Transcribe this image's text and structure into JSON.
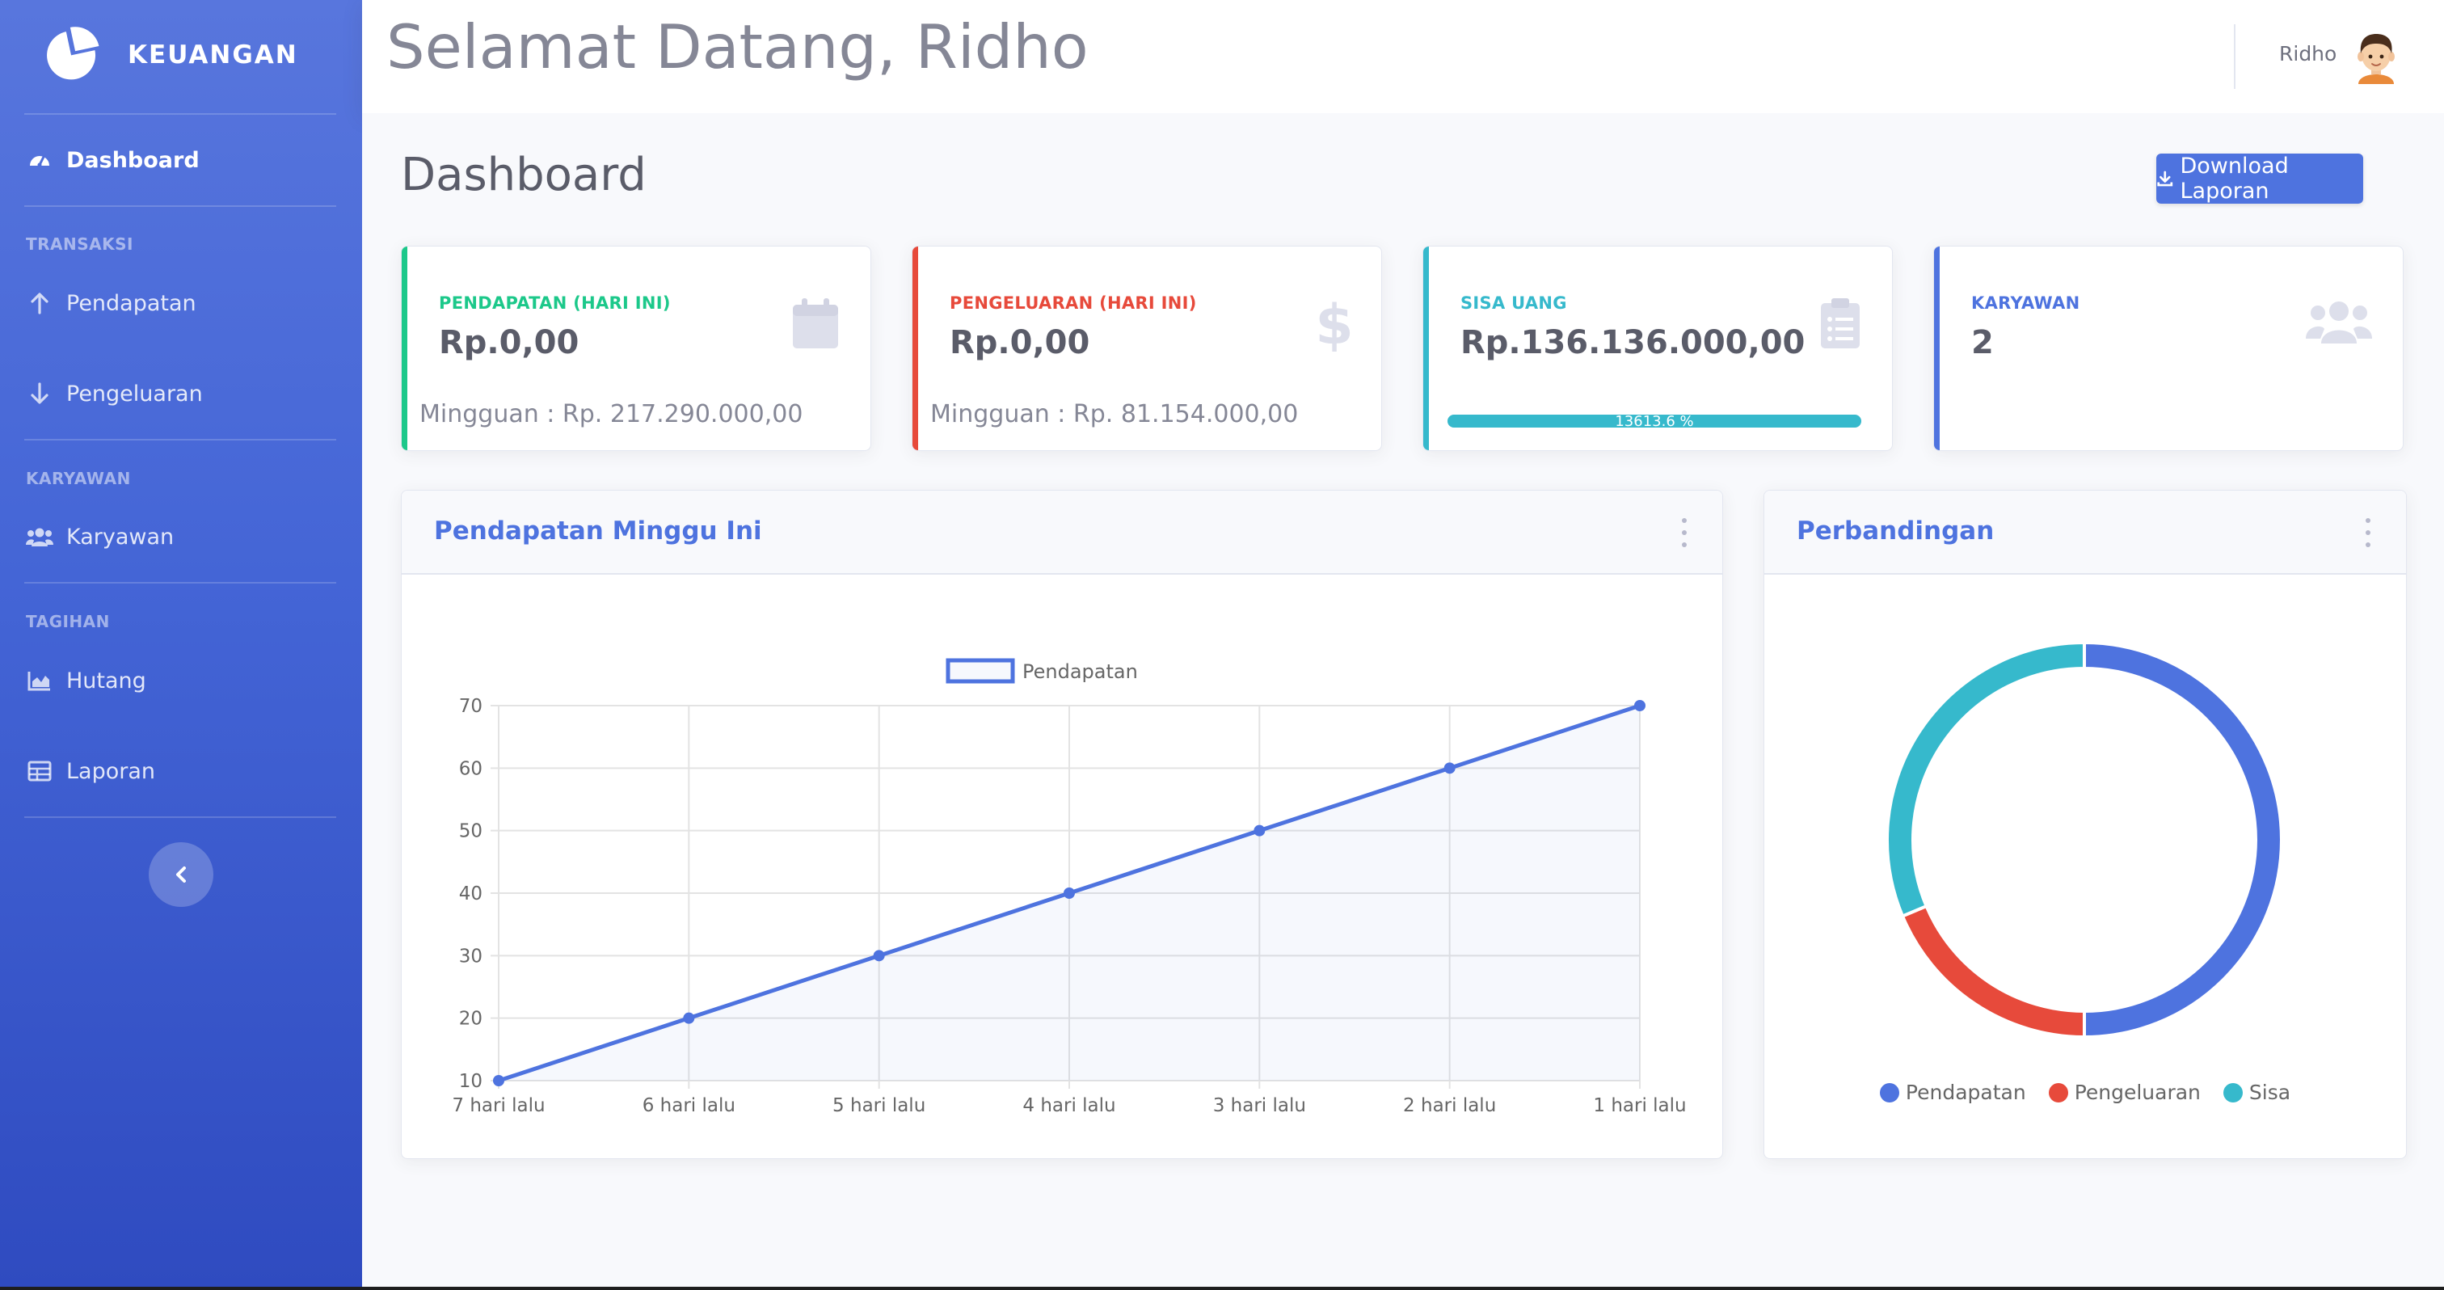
{
  "sidebar": {
    "brand": "KEUANGAN",
    "items": [
      {
        "label": "Dashboard"
      },
      {
        "heading": "TRANSAKSI"
      },
      {
        "label": "Pendapatan"
      },
      {
        "label": "Pengeluaran"
      },
      {
        "heading": "KARYAWAN"
      },
      {
        "label": "Karyawan"
      },
      {
        "heading": "TAGIHAN"
      },
      {
        "label": "Hutang"
      },
      {
        "label": "Laporan"
      }
    ]
  },
  "topbar": {
    "welcome": "Selamat Datang, Ridho",
    "user_name": "Ridho"
  },
  "page": {
    "title": "Dashboard",
    "download_label": "Download Laporan"
  },
  "cards": [
    {
      "label": "PENDAPATAN (HARI INI)",
      "value": "Rp.0,00",
      "sub": "Mingguan : Rp. 217.290.000,00",
      "color": "#1cc88a",
      "icon": "calendar-icon"
    },
    {
      "label": "PENGELUARAN (HARI INI)",
      "value": "Rp.0,00",
      "sub": "Mingguan : Rp. 81.154.000,00",
      "color": "#e74a3b",
      "icon": "dollar-icon"
    },
    {
      "label": "SISA UANG",
      "value": "Rp.136.136.000,00",
      "progress_text": "13613.6 %",
      "progress_fraction": 1.0,
      "color": "#36b9cc",
      "icon": "clipboard-list-icon"
    },
    {
      "label": "KARYAWAN",
      "value": "2",
      "color": "#4e73df",
      "icon": "users-icon"
    }
  ],
  "line_panel": {
    "title": "Pendapatan Minggu Ini"
  },
  "pie_panel": {
    "title": "Perbandingan"
  },
  "chart_data": [
    {
      "type": "line",
      "categories": [
        "7 hari lalu",
        "6 hari lalu",
        "5 hari lalu",
        "4 hari lalu",
        "3 hari lalu",
        "2 hari lalu",
        "1 hari lalu"
      ],
      "series": [
        {
          "name": "Pendapatan",
          "values": [
            10,
            20,
            30,
            40,
            50,
            60,
            70
          ]
        }
      ],
      "yticks": [
        10,
        20,
        30,
        40,
        50,
        60,
        70
      ],
      "ylim": [
        10,
        70
      ],
      "grid": true,
      "legend": "top-center",
      "color": "#4e73df"
    },
    {
      "type": "pie",
      "donut": true,
      "labels": [
        "Pendapatan",
        "Pengeluaran",
        "Sisa"
      ],
      "values": [
        217290000,
        81154000,
        136136000
      ],
      "colors": [
        "#4e73df",
        "#e74a3b",
        "#36b9cc"
      ],
      "legend": "bottom"
    }
  ]
}
